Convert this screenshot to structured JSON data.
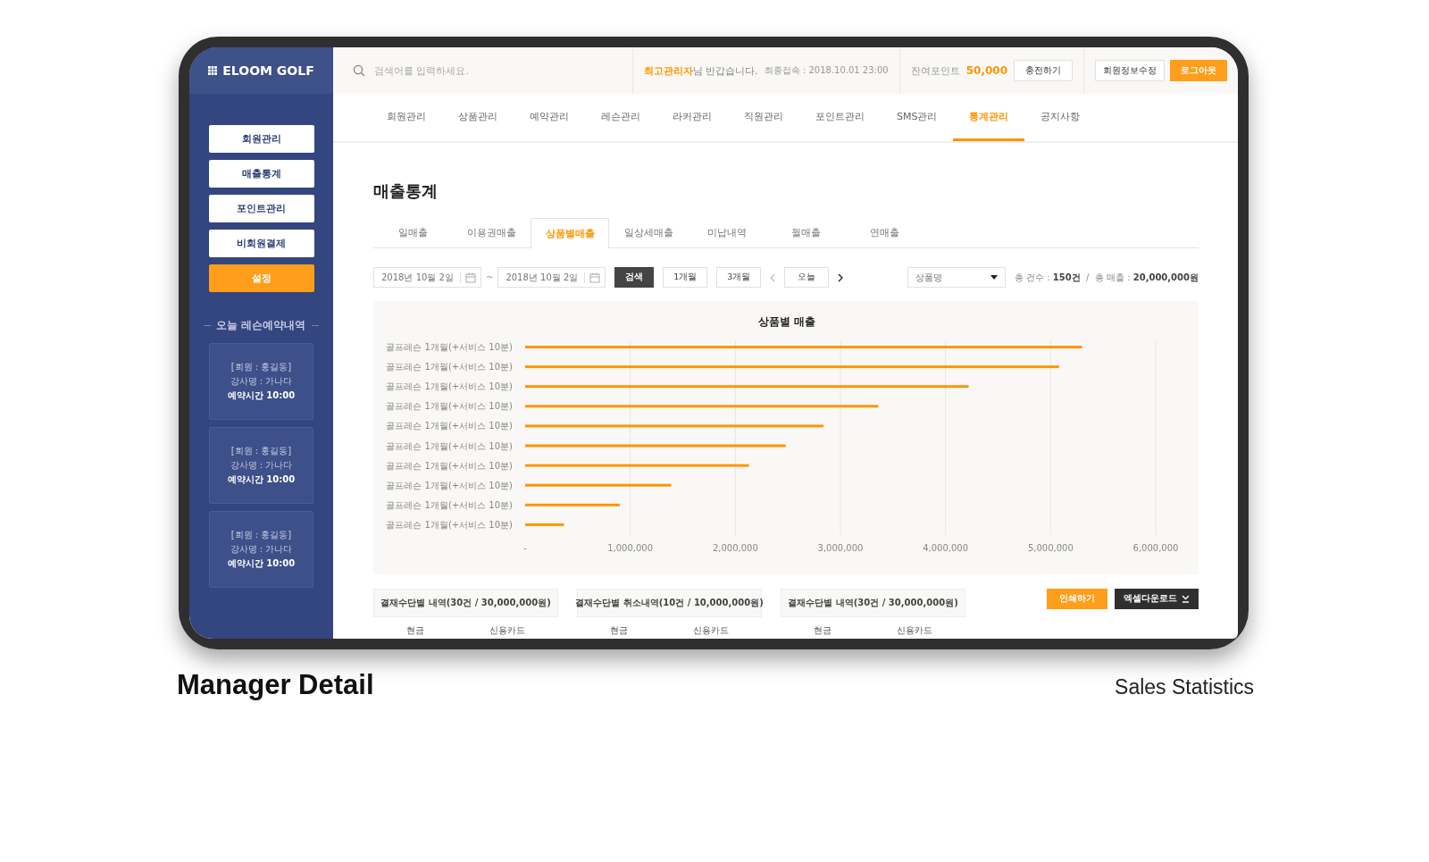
{
  "sidebar": {
    "logo": "ELOOM GOLF",
    "menu": [
      {
        "label": "회원관리",
        "selected": false
      },
      {
        "label": "매출통계",
        "selected": false
      },
      {
        "label": "포인트관리",
        "selected": false
      },
      {
        "label": "비회원결제",
        "selected": false
      },
      {
        "label": "설정",
        "selected": true
      }
    ],
    "section_title": "오늘 레슨예약내역",
    "reservations": [
      {
        "member": "[회원 : 홍길동]",
        "instructor": "강사명 : 가나다",
        "time": "예약시간 10:00"
      },
      {
        "member": "[회원 : 홍길동]",
        "instructor": "강사명 : 가나다",
        "time": "예약시간 10:00"
      },
      {
        "member": "[회원 : 홍길동]",
        "instructor": "강사명 : 가나다",
        "time": "예약시간 10:00"
      }
    ]
  },
  "topbar": {
    "search_placeholder": "검색어를 입력하세요.",
    "greeting": "**최고관리자**님 반갑습니다.",
    "last_login": "최종접속 : 2018.10.01 23:00",
    "points_label": "잔여포인트",
    "points_value": "50,000",
    "charge_button": "충전하기",
    "profile_button": "회원정보수정",
    "logout_button": "로그아웃"
  },
  "nav": [
    {
      "label": "회원관리",
      "selected": false
    },
    {
      "label": "상품관리",
      "selected": false
    },
    {
      "label": "예약관리",
      "selected": false
    },
    {
      "label": "레슨관리",
      "selected": false
    },
    {
      "label": "라커관리",
      "selected": false
    },
    {
      "label": "직원관리",
      "selected": false
    },
    {
      "label": "포인트관리",
      "selected": false
    },
    {
      "label": "SMS관리",
      "selected": false
    },
    {
      "label": "통계관리",
      "selected": true
    },
    {
      "label": "공지사항",
      "selected": false
    }
  ],
  "page_title": "매출통계",
  "subtabs": [
    {
      "label": "일매출",
      "selected": false
    },
    {
      "label": "이용권매출",
      "selected": false
    },
    {
      "label": "상품별매출",
      "selected": true
    },
    {
      "label": "일상세매출",
      "selected": false
    },
    {
      "label": "미납내역",
      "selected": false
    },
    {
      "label": "월매출",
      "selected": false
    },
    {
      "label": "연매출",
      "selected": false
    }
  ],
  "filter": {
    "date_from": "2018년 10월 2일",
    "separator": "~",
    "date_to": "2018년 10월 2일",
    "search_button": "검색",
    "periods": [
      "1개월",
      "3개월"
    ],
    "today_button": "오늘",
    "product_select": "상품명",
    "summary": "총 건수 : **150건**  /  총 매출 : **20,000,000원**"
  },
  "chart": {
    "chart_data": {
      "type": "bar",
      "orientation": "horizontal",
      "title": "상품별 매출",
      "categories": [
        "골프레슨 1개월(+서비스 10분)",
        "골프레슨 1개월(+서비스 10분)",
        "골프레슨 1개월(+서비스 10분)",
        "골프레슨 1개월(+서비스 10분)",
        "골프레슨 1개월(+서비스 10분)",
        "골프레슨 1개월(+서비스 10분)",
        "골프레슨 1개월(+서비스 10분)",
        "골프레슨 1개월(+서비스 10분)",
        "골프레슨 1개월(+서비스 10분)",
        "골프레슨 1개월(+서비스 10분)"
      ],
      "grid": true,
      "series": [
        {
          "color": "#ff9500",
          "values": [
            5300000,
            5080000,
            4220000,
            3360000,
            2840000,
            2480000,
            2130000,
            1390000,
            900000,
            370000
          ]
        }
      ],
      "xlim": [
        0,
        6000000
      ],
      "xticks": [
        {
          "value": 0,
          "label": "-"
        },
        {
          "value": 1000000,
          "label": "1,000,000"
        },
        {
          "value": 2000000,
          "label": "2,000,000"
        },
        {
          "value": 3000000,
          "label": "3,000,000"
        },
        {
          "value": 4000000,
          "label": "4,000,000"
        },
        {
          "value": 5000000,
          "label": "5,000,000"
        },
        {
          "value": 6000000,
          "label": "6,000,000"
        }
      ]
    }
  },
  "summaries": [
    {
      "title": "결재수단별 내역(30건 / 30,000,000원)",
      "columns": [
        "현금",
        "신용카드"
      ]
    },
    {
      "title": "결재수단별 취소내역(10건 / 10,000,000원)",
      "columns": [
        "현금",
        "신용카드"
      ]
    },
    {
      "title": "결재수단별 내역(30건 / 30,000,000원)",
      "columns": [
        "현금",
        "신용카드"
      ]
    }
  ],
  "actions": {
    "print_button": "인쇄하기",
    "excel_button": "엑셀다운로드"
  },
  "caption": {
    "title": "Manager Detail",
    "subtitle": "Sales Statistics"
  }
}
